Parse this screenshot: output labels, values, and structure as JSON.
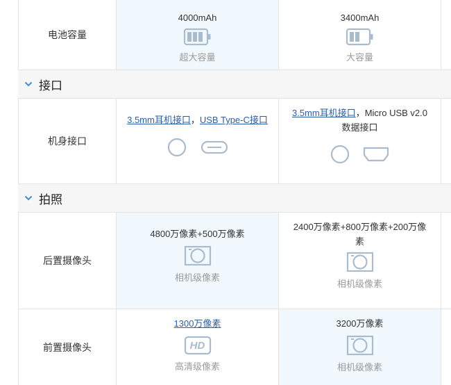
{
  "colors": {
    "accent": "#3f8ed4",
    "link": "#2b5fa3",
    "highlight_bg": "#f1f8fe",
    "section_bg": "#f6f6f6",
    "icon_stroke": "#a8bccd",
    "muted_text": "#9a9a9a"
  },
  "battery": {
    "label": "电池容量",
    "col1": {
      "value": "4000mAh",
      "sub": "超大容量",
      "icon": "battery-full-icon",
      "level": 1.0
    },
    "col2": {
      "value": "3400mAh",
      "sub": "大容量",
      "icon": "battery-half-icon",
      "level": 0.5
    }
  },
  "sections": {
    "ports": {
      "title": "接口",
      "icon": "chevron-down-icon"
    },
    "camera": {
      "title": "拍照",
      "icon": "chevron-down-icon"
    }
  },
  "ports": {
    "label": "机身接口",
    "col1": {
      "link1": "3.5mm耳机接口",
      "sep": "，",
      "link2": "USB Type-C接口",
      "icons": [
        "headphone-jack-icon",
        "usb-type-c-icon"
      ]
    },
    "col2": {
      "link1": "3.5mm耳机接口",
      "rest_line1": "，Micro USB v2.0",
      "rest_line2": "数据接口",
      "icons": [
        "headphone-jack-icon",
        "micro-usb-icon"
      ]
    }
  },
  "rear_camera": {
    "label": "后置摄像头",
    "col1": {
      "value": "4800万像素+500万像素",
      "sub": "相机级像素",
      "icon": "camera-lens-icon"
    },
    "col2": {
      "value_line1": "2400万像素+800万像素+200万像",
      "value_line2": "素",
      "sub": "相机级像素",
      "icon": "camera-lens-icon"
    }
  },
  "front_camera": {
    "label": "前置摄像头",
    "col1": {
      "value": "1300万像素",
      "sub": "高清级像素",
      "icon": "hd-icon",
      "icon_text": "HD"
    },
    "col2": {
      "value": "3200万像素",
      "sub": "相机级像素",
      "icon": "camera-lens-icon"
    }
  }
}
